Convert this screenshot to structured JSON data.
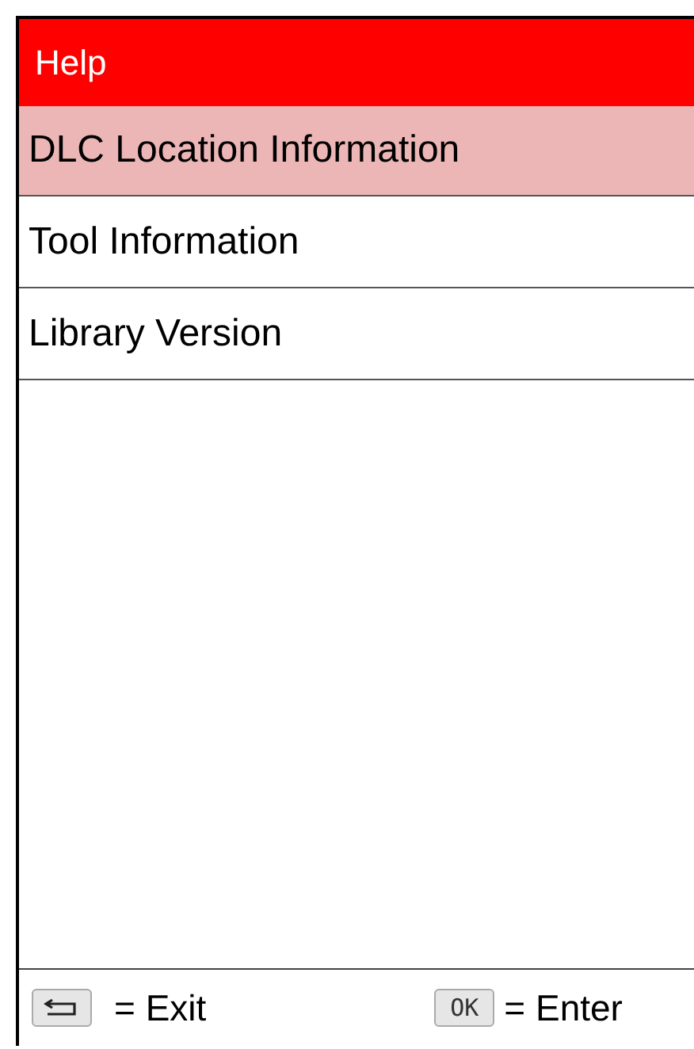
{
  "header": {
    "title": "Help"
  },
  "menu": [
    {
      "label": "DLC Location Information",
      "selected": true
    },
    {
      "label": "Tool Information",
      "selected": false
    },
    {
      "label": "Library Version",
      "selected": false
    }
  ],
  "footer": [
    {
      "kind": "back",
      "text": "= Exit"
    },
    {
      "kind": "ok",
      "key": "OK",
      "text": "= Enter"
    }
  ]
}
